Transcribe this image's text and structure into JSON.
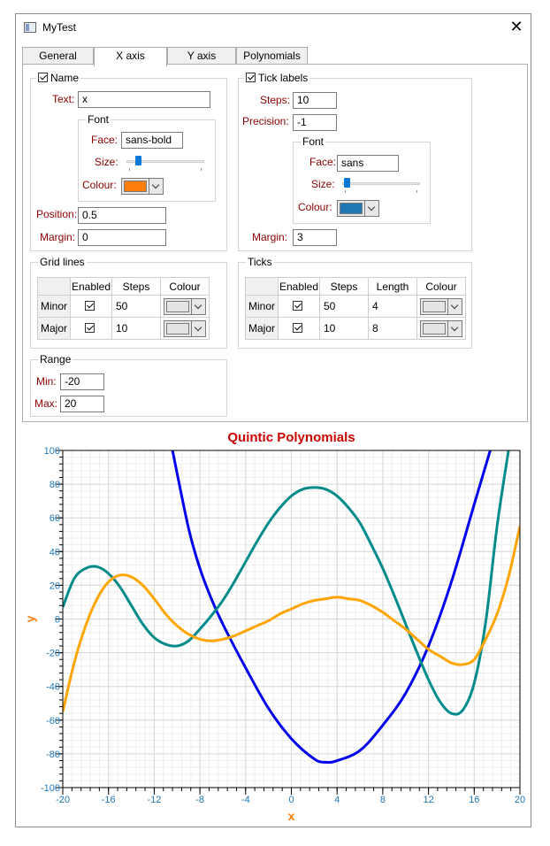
{
  "window": {
    "title": "MyTest"
  },
  "tabs": [
    {
      "label": "General",
      "active": false
    },
    {
      "label": "X axis",
      "active": true
    },
    {
      "label": "Y axis",
      "active": false
    },
    {
      "label": "Polynomials",
      "active": false
    }
  ],
  "name_group": {
    "checkbox_label": "Name",
    "checked": true,
    "text_label": "Text:",
    "text_value": "x",
    "font_group": {
      "title": "Font",
      "face_label": "Face:",
      "face_value": "sans-bold",
      "size_label": "Size:",
      "size_fraction": 0.12,
      "colour_label": "Colour:",
      "colour": "#ff7f0e"
    },
    "position_label": "Position:",
    "position_value": "0.5",
    "margin_label": "Margin:",
    "margin_value": "0"
  },
  "tick_labels_group": {
    "checkbox_label": "Tick labels",
    "checked": true,
    "steps_label": "Steps:",
    "steps_value": "10",
    "precision_label": "Precision:",
    "precision_value": "-1",
    "font_group": {
      "title": "Font",
      "face_label": "Face:",
      "face_value": "sans",
      "size_label": "Size:",
      "size_fraction": 0.02,
      "colour_label": "Colour:",
      "colour": "#1f77b4"
    },
    "margin_label": "Margin:",
    "margin_value": "3"
  },
  "grid_lines": {
    "title": "Grid lines",
    "headers": [
      "",
      "Enabled",
      "Steps",
      "Colour"
    ],
    "rows": [
      {
        "name": "Minor",
        "enabled": true,
        "steps": "50",
        "colour": "#e4e4e4"
      },
      {
        "name": "Major",
        "enabled": true,
        "steps": "10",
        "colour": "#e4e4e4"
      }
    ]
  },
  "ticks": {
    "title": "Ticks",
    "headers": [
      "",
      "Enabled",
      "Steps",
      "Length",
      "Colour"
    ],
    "rows": [
      {
        "name": "Minor",
        "enabled": true,
        "steps": "50",
        "length": "4",
        "colour": "#e4e4e4"
      },
      {
        "name": "Major",
        "enabled": true,
        "steps": "10",
        "length": "8",
        "colour": "#e4e4e4"
      }
    ]
  },
  "range": {
    "title": "Range",
    "min_label": "Min:",
    "min_value": "-20",
    "max_label": "Max:",
    "max_value": "20"
  },
  "colors": {
    "label_text": "#8b0000",
    "axis_ticks": "#1f77b4",
    "x_name": "#ff7f0e",
    "y_name": "#ff7f0e",
    "title": "#cc0000"
  },
  "chart_data": {
    "type": "line",
    "title": "Quintic Polynomials",
    "xlabel": "x",
    "ylabel": "y",
    "xlim": [
      -20,
      20
    ],
    "ylim": [
      -100,
      100
    ],
    "xticks": [
      -20,
      -16,
      -12,
      -8,
      -4,
      0,
      4,
      8,
      12,
      16,
      20
    ],
    "yticks": [
      -100,
      -80,
      -60,
      -40,
      -20,
      0,
      20,
      40,
      60,
      80,
      100
    ],
    "grid": true,
    "series": [
      {
        "color": "#0000ee",
        "x": [
          -10.4,
          -9,
          -8,
          -7,
          -6,
          -4,
          -2,
          0,
          2,
          3,
          4,
          6,
          8,
          10,
          12,
          14,
          16,
          17.4
        ],
        "y": [
          100,
          54,
          30,
          12,
          -3,
          -29,
          -53,
          -71,
          -83,
          -85,
          -84,
          -78,
          -63,
          -44,
          -16,
          22,
          68,
          100
        ]
      },
      {
        "color": "#008b8b",
        "x": [
          -20,
          -19,
          -18,
          -17,
          -16,
          -15,
          -14,
          -13,
          -12,
          -11,
          -10,
          -9,
          -8,
          -7,
          -6,
          -5,
          -4,
          -3,
          -2,
          -1,
          0,
          1,
          2,
          3,
          4,
          5,
          6,
          7,
          8,
          9,
          10,
          11,
          12,
          13,
          14,
          15,
          16,
          17,
          18,
          19
        ],
        "y": [
          7,
          24,
          30,
          31,
          27,
          19,
          8,
          -3,
          -11,
          -15,
          -16,
          -13,
          -6,
          2,
          11,
          22,
          34,
          46,
          57,
          66,
          73,
          77,
          78,
          77,
          73,
          66,
          57,
          44,
          30,
          14,
          -3,
          -20,
          -36,
          -49,
          -56,
          -54,
          -38,
          -2,
          55,
          100
        ]
      },
      {
        "color": "#ffa500",
        "x": [
          -20,
          -19,
          -18,
          -17,
          -16,
          -15,
          -14,
          -13,
          -12,
          -11,
          -10,
          -9,
          -8,
          -7,
          -6,
          -5,
          -4,
          -3,
          -2,
          -1,
          0,
          1,
          2,
          3,
          4,
          5,
          6,
          7,
          8,
          9,
          10,
          11,
          12,
          13,
          14,
          15,
          16,
          17,
          18,
          19,
          20
        ],
        "y": [
          -55,
          -26,
          -4,
          12,
          22,
          26,
          25,
          20,
          12,
          3,
          -4,
          -9,
          -12,
          -13,
          -12,
          -10,
          -7,
          -4,
          -1,
          3,
          6,
          9,
          11,
          12,
          13,
          12,
          11,
          8,
          4,
          -1,
          -6,
          -12,
          -18,
          -22,
          -26,
          -27,
          -24,
          -12,
          3,
          25,
          55
        ]
      }
    ]
  }
}
